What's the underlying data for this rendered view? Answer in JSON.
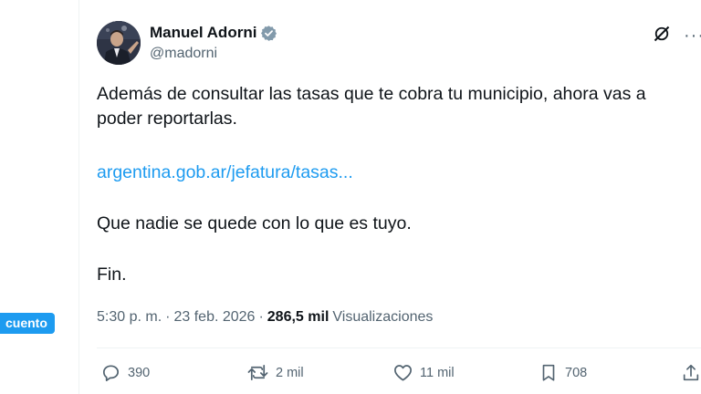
{
  "sidebar": {
    "badge_label": "cuento"
  },
  "tweet": {
    "author_name": "Manuel Adorni",
    "author_handle": "@madorni",
    "text_line1": "Además de consultar las tasas que te cobra tu municipio, ahora vas a poder reportarlas.",
    "link_text": "argentina.gob.ar/jefatura/tasas...",
    "text_line2": "Que nadie se quede con lo que es tuyo.",
    "text_line3": "Fin.",
    "time": "5:30 p. m.",
    "date": "23 feb. 2026",
    "views_count": "286,5 mil",
    "views_label": "Visualizaciones",
    "sep": "·"
  },
  "actions": {
    "replies": "390",
    "reposts": "2 mil",
    "likes": "11 mil",
    "bookmarks": "708"
  },
  "colors": {
    "accent": "#1d9bf0",
    "text_primary": "#0f1419",
    "text_secondary": "#536471",
    "divider": "#eff3f4"
  },
  "icons": [
    "verified-badge-icon",
    "grok-icon",
    "more-icon",
    "reply-icon",
    "repost-icon",
    "like-icon",
    "bookmark-icon",
    "share-icon"
  ]
}
